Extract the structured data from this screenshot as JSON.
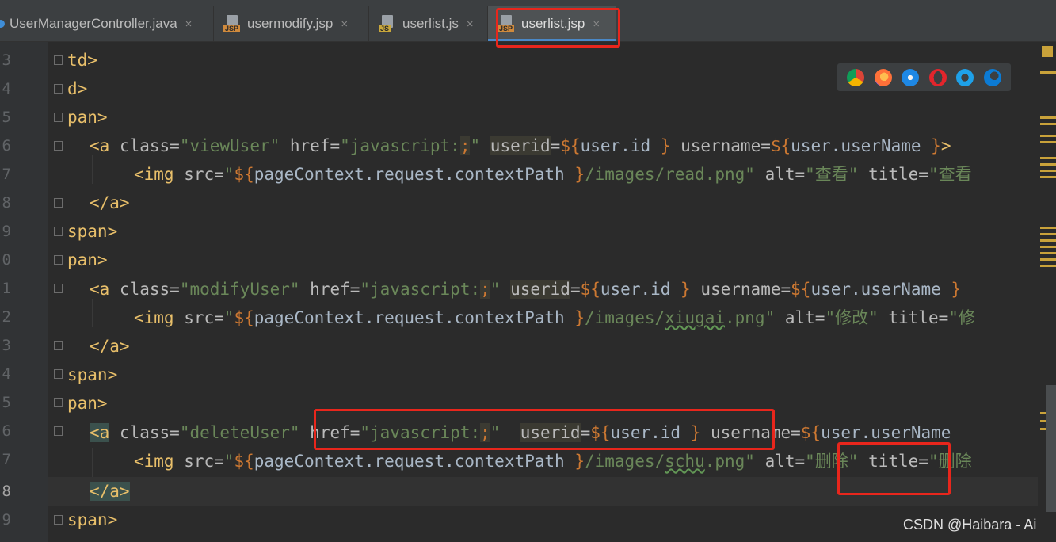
{
  "tabs": [
    {
      "label": "UserManagerController.java",
      "icon": "java-class-icon",
      "active": false
    },
    {
      "label": "usermodify.jsp",
      "icon": "jsp-file-icon",
      "badge": "JSP",
      "active": false
    },
    {
      "label": "userlist.js",
      "icon": "js-file-icon",
      "badge": "JS",
      "active": false
    },
    {
      "label": "userlist.jsp",
      "icon": "jsp-file-icon",
      "badge": "JSP",
      "active": true
    }
  ],
  "close_glyph": "×",
  "line_numbers": [
    "3",
    "4",
    "5",
    "6",
    "7",
    "8",
    "9",
    "0",
    "1",
    "2",
    "3",
    "4",
    "5",
    "6",
    "7",
    "8",
    "9"
  ],
  "code": {
    "l1": {
      "t": "td>"
    },
    "l2": {
      "t": "d>"
    },
    "l3": {
      "t": "pan>"
    },
    "l4": {
      "a": "<a",
      "b": " class=",
      "c": "\"viewUser\"",
      "d": " href=",
      "e": "\"javascript:",
      "f": ";",
      "g": "\"",
      "h": " ",
      "i": "userid",
      "j": "=",
      "k": "${",
      "l": "user.id",
      "m": " }",
      "n": " username=",
      "o": "${",
      "p": "user.userName",
      "q": " }",
      "r": ">"
    },
    "l5": {
      "a": "<img",
      "b": " src=",
      "c": "\"",
      "d": "${",
      "e": "pageContext.request.contextPath",
      "f": " }",
      "g": "/images/read.png\"",
      "h": " alt=",
      "i": "\"查看\"",
      "j": " title=",
      "k": "\"查看"
    },
    "l6": {
      "t": "</a>"
    },
    "l7": {
      "t": "span>"
    },
    "l8": {
      "t": "pan>"
    },
    "l9": {
      "a": "<a",
      "b": " class=",
      "c": "\"modifyUser\"",
      "d": " href=",
      "e": "\"javascript:",
      "f": ";",
      "g": "\"",
      "h": " ",
      "i": "userid",
      "j": "=",
      "k": "${",
      "l": "user.id",
      "m": " }",
      "n": " username=",
      "o": "${",
      "p": "user.userName",
      "q": " }"
    },
    "l10": {
      "a": "<img",
      "b": " src=",
      "c": "\"",
      "d": "${",
      "e": "pageContext.request.contextPath",
      "f": " }",
      "g": "/images/",
      "g2": "xiugai",
      ".g3": "",
      "g3": ".png\"",
      "h": " alt=",
      "i": "\"修改\"",
      "j": " title=",
      "k": "\"修"
    },
    "l11": {
      "t": "</a>"
    },
    "l12": {
      "t": "span>"
    },
    "l13": {
      "t": "pan>"
    },
    "l14": {
      "a": "<a",
      "b": " class=",
      "c": "\"deleteUser\"",
      "d": " href=",
      "e": "\"javascript:",
      "f": ";",
      "g": "\"",
      "h": "  ",
      "i": "userid",
      "j": "=",
      "k": "${",
      "l": "user.id",
      "m": " }",
      "n": " username=",
      "o": "${",
      "p": "user.userName"
    },
    "l15": {
      "a": "<img",
      "b": " src=",
      "c": "\"",
      "d": "${",
      "e": "pageContext.request.contextPath",
      "f": " }",
      "g": "/images/",
      "g2": "schu",
      "g3": ".png\"",
      "h": " alt=",
      "i": "\"删除\"",
      "j": " title=",
      "k": "\"删除"
    },
    "l16": {
      "t": "</a>"
    },
    "l17": {
      "t": "span>"
    }
  },
  "browsers": [
    "chrome-icon",
    "firefox-icon",
    "safari-icon",
    "opera-icon",
    "ie-icon",
    "edge-icon"
  ],
  "watermark": "CSDN @Haibara - Ai",
  "colors": {
    "highlight_red": "#e8261c",
    "accent_blue": "#4a88c7"
  }
}
